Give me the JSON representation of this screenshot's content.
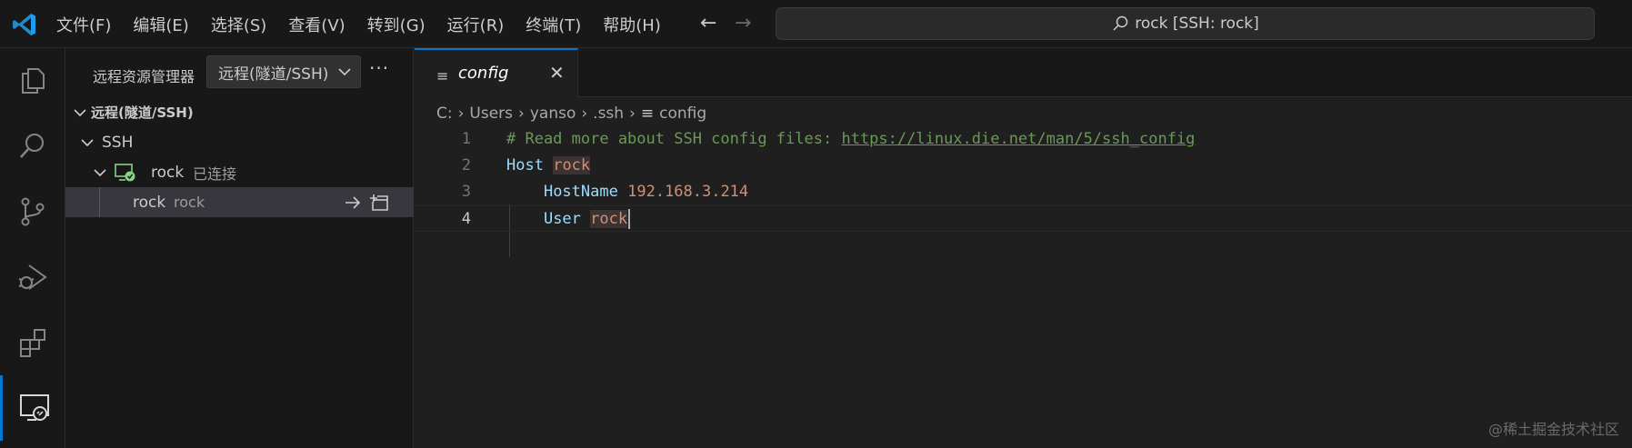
{
  "menu": [
    "文件(F)",
    "编辑(E)",
    "选择(S)",
    "查看(V)",
    "转到(G)",
    "运行(R)",
    "终端(T)",
    "帮助(H)"
  ],
  "command_center": {
    "text": "rock [SSH: rock]",
    "icon": "search-icon"
  },
  "activity_bar": [
    {
      "name": "explorer",
      "icon": "files-icon"
    },
    {
      "name": "search",
      "icon": "search-icon"
    },
    {
      "name": "source-control",
      "icon": "source-control-icon"
    },
    {
      "name": "run-debug",
      "icon": "run-debug-icon"
    },
    {
      "name": "extensions",
      "icon": "extensions-icon"
    },
    {
      "name": "remote-explorer",
      "icon": "remote-explorer-icon",
      "active": true
    }
  ],
  "sidebar": {
    "title": "远程资源管理器",
    "select_value": "远程(隧道/SSH)",
    "more": "···",
    "tree": {
      "root": "远程(隧道/SSH)",
      "group": "SSH",
      "host": {
        "label": "rock",
        "status": "已连接"
      },
      "connection": {
        "label": "rock",
        "desc": "rock"
      }
    }
  },
  "editor": {
    "tab": {
      "label": "config",
      "close": "✕"
    },
    "breadcrumb": [
      "C:",
      "Users",
      "yanso",
      ".ssh",
      "config"
    ],
    "lines": [
      {
        "n": "1",
        "comment": "# Read more about SSH config files: ",
        "link": "https://linux.die.net/man/5/ssh_config"
      },
      {
        "n": "2",
        "key": "Host",
        "value": "rock"
      },
      {
        "n": "3",
        "key": "HostName",
        "value": "192.168.3.214"
      },
      {
        "n": "4",
        "key": "User",
        "value": "rock"
      }
    ]
  },
  "watermark": "@稀土掘金技术社区",
  "colors": {
    "accent": "#0078d4",
    "connected": "#89d185",
    "comment": "#6a9955",
    "keyword": "#9cdcfe",
    "string": "#ce9178"
  }
}
